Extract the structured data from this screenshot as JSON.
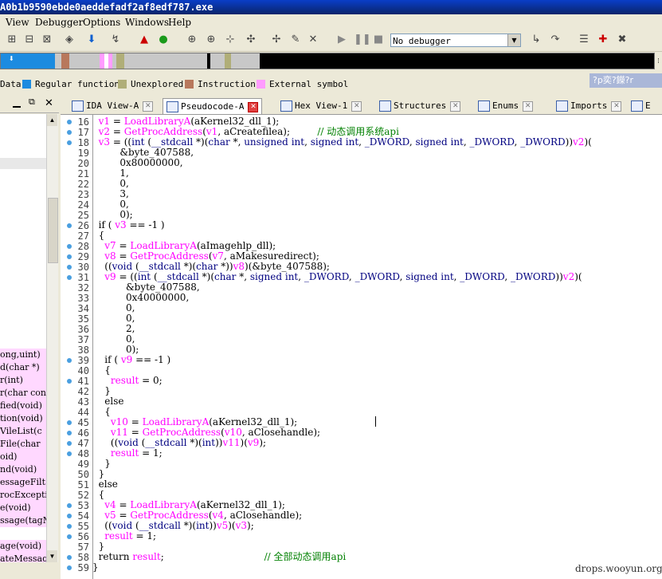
{
  "window": {
    "title": "A0b1b9590ebde0aeddefadf2af8edf787.exe"
  },
  "menu": [
    "View",
    "Debugger",
    "Options",
    "Windows",
    "Help"
  ],
  "toolbar": {
    "debugger_select": "No debugger"
  },
  "legend": [
    {
      "label": "Data",
      "color": "#c8c8c8"
    },
    {
      "label": "Regular function",
      "color": "#1c8be0"
    },
    {
      "label": "Unexplored",
      "color": "#b0ae78"
    },
    {
      "label": "Instruction",
      "color": "#b8785c"
    },
    {
      "label": "External symbol",
      "color": "#ff9cff"
    }
  ],
  "help_text": "?p奕?鑅?r",
  "left_panel": {
    "rows": [
      "ong,uint)",
      "d(char *)",
      "r(int)",
      "r(char con",
      "fied(void)",
      "tion(void)",
      "VileList(c",
      "File(char",
      "oid)",
      "nd(void)",
      "essageFilt",
      "rocExcepti",
      "e(void)",
      "ssage(tagM",
      "",
      "age(void)",
      "ateMessag"
    ]
  },
  "tabs": [
    {
      "label": "IDA View-A",
      "active": false
    },
    {
      "label": "Pseudocode-A",
      "active": true
    },
    {
      "label": "Hex View-1",
      "active": false
    },
    {
      "label": "Structures",
      "active": false
    },
    {
      "label": "Enums",
      "active": false
    },
    {
      "label": "Imports",
      "active": false
    },
    {
      "label": "E",
      "active": false
    }
  ],
  "code": [
    {
      "n": "16",
      "bp": true,
      "t": "  v1 = LoadLibraryA(aKernel32_dll_1);"
    },
    {
      "n": "17",
      "bp": true,
      "t": "  v2 = GetProcAddress(v1, aCreatefilea);         // 动态调用系统api"
    },
    {
      "n": "18",
      "bp": true,
      "t": "  v3 = ((int (__stdcall *)(char *, unsigned int, signed int, _DWORD, signed int, _DWORD, _DWORD))v2)("
    },
    {
      "n": "19",
      "bp": false,
      "t": "         &byte_407588,"
    },
    {
      "n": "20",
      "bp": false,
      "t": "         0x80000000,"
    },
    {
      "n": "21",
      "bp": false,
      "t": "         1,"
    },
    {
      "n": "22",
      "bp": false,
      "t": "         0,"
    },
    {
      "n": "23",
      "bp": false,
      "t": "         3,"
    },
    {
      "n": "24",
      "bp": false,
      "t": "         0,"
    },
    {
      "n": "25",
      "bp": false,
      "t": "         0);"
    },
    {
      "n": "26",
      "bp": true,
      "t": "  if ( v3 == -1 )"
    },
    {
      "n": "27",
      "bp": false,
      "t": "  {"
    },
    {
      "n": "28",
      "bp": true,
      "t": "    v7 = LoadLibraryA(aImagehlp_dll);"
    },
    {
      "n": "29",
      "bp": true,
      "t": "    v8 = GetProcAddress(v7, aMakesuredirect);"
    },
    {
      "n": "30",
      "bp": true,
      "t": "    ((void (__stdcall *)(char *))v8)(&byte_407588);"
    },
    {
      "n": "31",
      "bp": true,
      "t": "    v9 = ((int (__stdcall *)(char *, signed int, _DWORD, _DWORD, signed int, _DWORD, _DWORD))v2)("
    },
    {
      "n": "32",
      "bp": false,
      "t": "           &byte_407588,"
    },
    {
      "n": "33",
      "bp": false,
      "t": "           0x40000000,"
    },
    {
      "n": "34",
      "bp": false,
      "t": "           0,"
    },
    {
      "n": "35",
      "bp": false,
      "t": "           0,"
    },
    {
      "n": "36",
      "bp": false,
      "t": "           2,"
    },
    {
      "n": "37",
      "bp": false,
      "t": "           0,"
    },
    {
      "n": "38",
      "bp": false,
      "t": "           0);"
    },
    {
      "n": "39",
      "bp": true,
      "t": "    if ( v9 == -1 )"
    },
    {
      "n": "40",
      "bp": false,
      "t": "    {"
    },
    {
      "n": "41",
      "bp": true,
      "t": "      result = 0;"
    },
    {
      "n": "42",
      "bp": false,
      "t": "    }"
    },
    {
      "n": "43",
      "bp": false,
      "t": "    else"
    },
    {
      "n": "44",
      "bp": false,
      "t": "    {"
    },
    {
      "n": "45",
      "bp": true,
      "t": "      v10 = LoadLibraryA(aKernel32_dll_1);"
    },
    {
      "n": "46",
      "bp": true,
      "t": "      v11 = GetProcAddress(v10, aClosehandle);"
    },
    {
      "n": "47",
      "bp": true,
      "t": "      ((void (__stdcall *)(int))v11)(v9);"
    },
    {
      "n": "48",
      "bp": true,
      "t": "      result = 1;"
    },
    {
      "n": "49",
      "bp": false,
      "t": "    }"
    },
    {
      "n": "50",
      "bp": false,
      "t": "  }"
    },
    {
      "n": "51",
      "bp": false,
      "t": "  else"
    },
    {
      "n": "52",
      "bp": false,
      "t": "  {"
    },
    {
      "n": "53",
      "bp": true,
      "t": "    v4 = LoadLibraryA(aKernel32_dll_1);"
    },
    {
      "n": "54",
      "bp": true,
      "t": "    v5 = GetProcAddress(v4, aClosehandle);"
    },
    {
      "n": "55",
      "bp": true,
      "t": "    ((void (__stdcall *)(int))v5)(v3);"
    },
    {
      "n": "56",
      "bp": true,
      "t": "    result = 1;"
    },
    {
      "n": "57",
      "bp": false,
      "t": "  }"
    },
    {
      "n": "58",
      "bp": true,
      "t": "  return result;                                 // 全部动态调用api"
    },
    {
      "n": "59",
      "bp": true,
      "t": "}"
    }
  ],
  "watermark": "drops.wooyun.org"
}
